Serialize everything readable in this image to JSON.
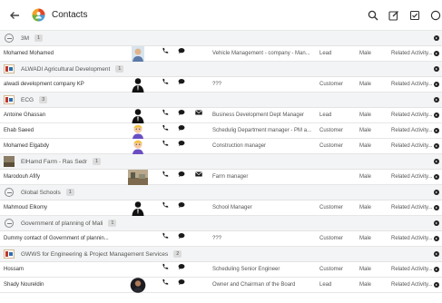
{
  "app": {
    "title": "Contacts",
    "accent": "#1e88e5"
  },
  "toolbar": {
    "icons": [
      "search-icon",
      "edit-icon",
      "checkbox-icon",
      "settings-icon"
    ]
  },
  "groups": [
    {
      "label": "3M",
      "count": "1",
      "icon": "collapse-icon",
      "rows": [
        {
          "name": "Mohamed Mohamed",
          "photo": "person-photo",
          "mail": false,
          "title": "Vehicle Management - company - Man...",
          "status": "Lead",
          "gender": "Male",
          "related": "Related Activity..."
        }
      ]
    },
    {
      "label": "ALWADI Agricultural Development",
      "count": "1",
      "icon": "company-logo-icon",
      "rows": [
        {
          "name": "alwadi development company KP",
          "photo": "silhouette",
          "mail": false,
          "title": "???",
          "status": "Customer",
          "gender": "Male",
          "related": "Related Activity..."
        }
      ]
    },
    {
      "label": "ECG",
      "count": "3",
      "icon": "company-logo-icon",
      "rows": [
        {
          "name": "Antoine Ghassan",
          "photo": "silhouette",
          "mail": true,
          "title": "Business Development Dept Manager",
          "status": "Lead",
          "gender": "Male",
          "related": "Related Activity..."
        },
        {
          "name": "Ehab Saeed",
          "photo": "avatar-cartoon",
          "mail": false,
          "title": "Schedulig Department manager - PM a...",
          "status": "Customer",
          "gender": "Male",
          "related": "Related Activity..."
        },
        {
          "name": "Mohamed Elgabdy",
          "photo": "avatar-cartoon",
          "mail": false,
          "title": "Construction manager",
          "status": "Customer",
          "gender": "Male",
          "related": "Related Activity..."
        }
      ]
    },
    {
      "label": "ElHamd Farm - Ras Sedr",
      "count": "1",
      "icon": "farm-photo-icon",
      "rows": [
        {
          "name": "Marodouh Afify",
          "photo": "farm-photo",
          "mail": true,
          "title": "Farm manager",
          "status": "",
          "gender": "Male",
          "related": "Related Activity..."
        }
      ]
    },
    {
      "label": "Global Schools",
      "count": "1",
      "icon": "collapse-icon",
      "rows": [
        {
          "name": "Mahmoud Elkomy",
          "photo": "silhouette",
          "mail": false,
          "title": "School Manager",
          "status": "Customer",
          "gender": "Male",
          "related": "Related Activity..."
        }
      ]
    },
    {
      "label": "Government of planning of Mali",
      "count": "1",
      "icon": "collapse-icon",
      "rows": [
        {
          "name": "Dummy contact of Government of plannin...",
          "photo": "",
          "mail": false,
          "title": "???",
          "status": "Customer",
          "gender": "Male",
          "related": "Related Activity..."
        }
      ]
    },
    {
      "label": "GWWS for Engineering & Project Management Services",
      "count": "2",
      "icon": "company-logo-icon",
      "rows": [
        {
          "name": "Hossam",
          "photo": "",
          "mail": false,
          "title": "Scheduling Senior Engineer",
          "status": "Customer",
          "gender": "Male",
          "related": "Related Activity..."
        },
        {
          "name": "Shady Noureldin",
          "photo": "portrait-photo",
          "mail": false,
          "title": "Owner and Chairman of the Board",
          "status": "Lead",
          "gender": "Male",
          "related": "Related Activity..."
        }
      ]
    }
  ]
}
